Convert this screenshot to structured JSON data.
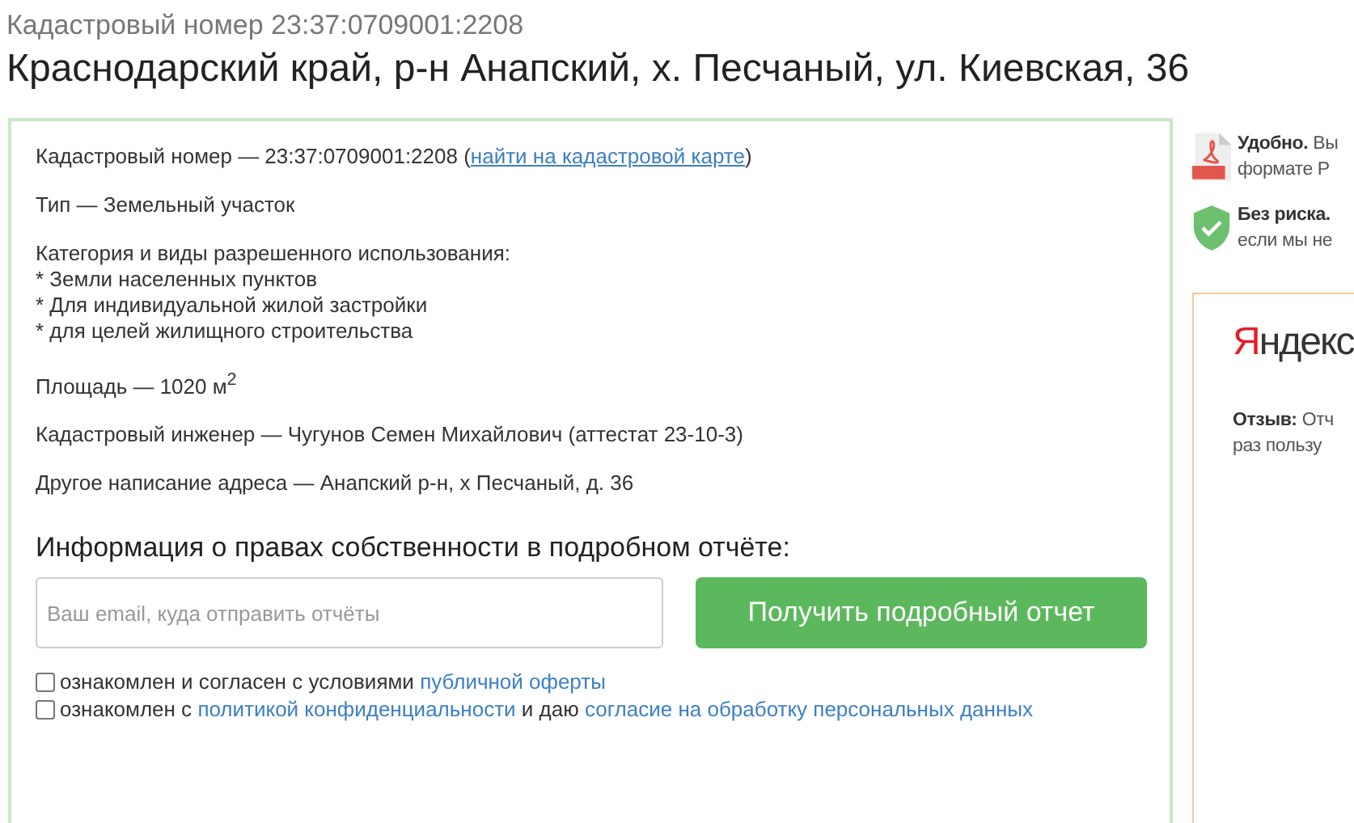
{
  "header": {
    "subtitle": "Кадастровый номер 23:37:0709001:2208",
    "title": "Краснодарский край, р-н Анапский, х. Песчаный, ул. Киевская, 36"
  },
  "details": [
    {
      "kind": "link_line",
      "text": "Кадастровый номер — 23:37:0709001:2208 (",
      "link": "найти на кадастровой карте",
      "after": ")"
    },
    {
      "kind": "text",
      "text": "Тип — Земельный участок"
    },
    {
      "kind": "list",
      "text": "Категория и виды разрешенного использования:",
      "items": [
        "* Земли населенных пунктов",
        "* Для индивидуальной жилой застройки",
        "* для целей жилищного строительства"
      ]
    },
    {
      "kind": "text",
      "text": "Площадь — 1020 м$^{2}$"
    },
    {
      "kind": "text",
      "text": "Кадастровый инженер — Чугунов Семен Михайлович (аттестат 23-10-3)"
    },
    {
      "kind": "text",
      "text": "Другое написание адреса — Анапский р-н, х Песчаный, д. 36"
    }
  ],
  "order": {
    "heading": "Информация о правах собственности в подробном отчёте:",
    "email": {
      "placeholder": "Ваш email, куда отправить отчёты"
    },
    "button": "Получить подробный отчет",
    "agreements": [
      {
        "checked": false,
        "parts": [
          {
            "kind": "text",
            "text": "ознакомлен и согласен с условиями "
          },
          {
            "kind": "link",
            "text": "публичной оферты"
          }
        ]
      },
      {
        "checked": false,
        "parts": [
          {
            "kind": "text",
            "text": "ознакомлен с "
          },
          {
            "kind": "link",
            "text": "политикой конфиденциальности"
          },
          {
            "kind": "text",
            "text": " и даю "
          },
          {
            "kind": "link",
            "text": "согласие на обработку персональных данных"
          }
        ]
      }
    ]
  },
  "benefits": [
    {
      "kind": "pdf",
      "lines": [
        "**Удобно.** Вы",
        "формате Р"
      ]
    },
    {
      "kind": "shield",
      "lines": [
        "**Без риска.**",
        "если мы не"
      ]
    }
  ],
  "review": {
    "logo_first": "Я",
    "logo_rest": "ндекс",
    "text_lines": [
      "**Отзыв:** Отч",
      "раз пользу"
    ]
  }
}
